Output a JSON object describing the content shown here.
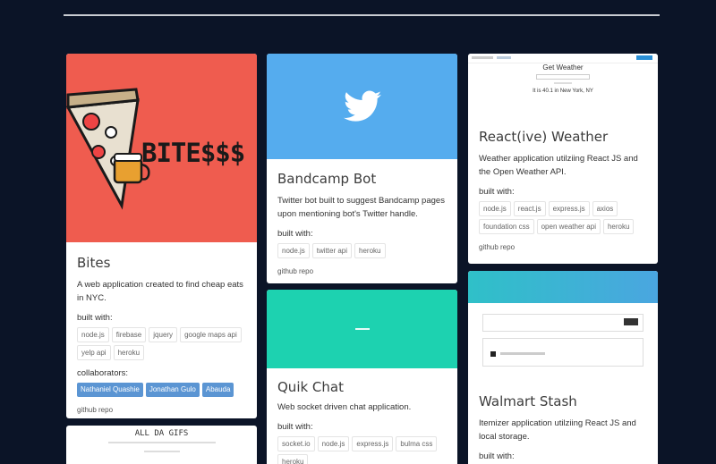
{
  "cards": {
    "bites": {
      "title": "Bites",
      "logo_text": "BITE$$$",
      "description": "A web application created to find cheap eats in NYC.",
      "built_with_label": "built with:",
      "tags": [
        "node.js",
        "firebase",
        "jquery",
        "google maps api",
        "yelp api",
        "heroku"
      ],
      "collaborators_label": "collaborators:",
      "collaborators": [
        "Nathaniel Quashie",
        "Jonathan Gulo",
        "Abauda"
      ],
      "repo_label": "github repo"
    },
    "alldagifs": {
      "heading": "ALL DA GIFS"
    },
    "bandcamp": {
      "title": "Bandcamp Bot",
      "description": "Twitter bot built to suggest Bandcamp pages upon mentioning bot's Twitter handle.",
      "built_with_label": "built with:",
      "tags": [
        "node.js",
        "twitter api",
        "heroku"
      ],
      "repo_label": "github repo"
    },
    "quikchat": {
      "title": "Quik Chat",
      "description": "Web socket driven chat application.",
      "built_with_label": "built with:",
      "tags": [
        "socket.io",
        "node.js",
        "express.js",
        "bulma css",
        "heroku"
      ]
    },
    "weather": {
      "title": "React(ive) Weather",
      "screenshot_heading": "Get Weather",
      "screenshot_result": "It is 40.1 in New York, NY",
      "description": "Weather application utilziing React JS and the Open Weather API.",
      "built_with_label": "built with:",
      "tags": [
        "node.js",
        "react.js",
        "express.js",
        "axios",
        "foundation css",
        "open weather api",
        "heroku"
      ],
      "repo_label": "github repo"
    },
    "walmart": {
      "title": "Walmart Stash",
      "description": "Itemizer application utilziing React JS and local storage.",
      "built_with_label": "built with:"
    }
  },
  "colors": {
    "background": "#0b1427",
    "bites_hero": "#ef5c4f",
    "twitter_blue": "#55acee",
    "quik_green": "#1dd2b0",
    "collab_blue": "#5b95d3"
  }
}
